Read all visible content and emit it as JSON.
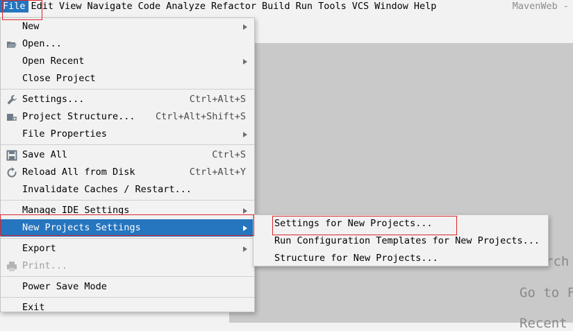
{
  "menubar": {
    "items": [
      "File",
      "Edit",
      "View",
      "Navigate",
      "Code",
      "Analyze",
      "Refactor",
      "Build",
      "Run",
      "Tools",
      "VCS",
      "Window",
      "Help"
    ],
    "window_title": "MavenWeb -"
  },
  "file_menu": {
    "new": "New",
    "open": "Open...",
    "open_recent": "Open Recent",
    "close_project": "Close Project",
    "settings": "Settings...",
    "settings_shortcut": "Ctrl+Alt+S",
    "project_structure": "Project Structure...",
    "project_structure_shortcut": "Ctrl+Alt+Shift+S",
    "file_properties": "File Properties",
    "save_all": "Save All",
    "save_all_shortcut": "Ctrl+S",
    "reload_all": "Reload All from Disk",
    "reload_all_shortcut": "Ctrl+Alt+Y",
    "invalidate_caches": "Invalidate Caches / Restart...",
    "manage_ide_settings": "Manage IDE Settings",
    "new_projects_settings": "New Projects Settings",
    "export": "Export",
    "print": "Print...",
    "power_save_mode": "Power Save Mode",
    "exit": "Exit"
  },
  "submenu": {
    "settings_new_projects": "Settings for New Projects...",
    "run_config_templates": "Run Configuration Templates for New Projects...",
    "structure_new_projects": "Structure for New Projects..."
  },
  "background_hints": {
    "search": "rch",
    "goto": "Go to F",
    "recent": "Recent"
  },
  "colors": {
    "selection": "#2675bf",
    "highlight_box": "#d9252a"
  }
}
